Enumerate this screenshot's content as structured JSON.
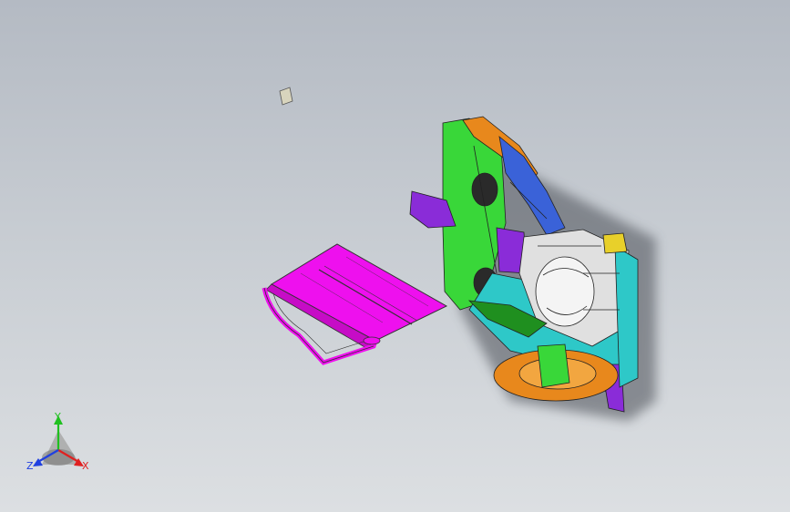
{
  "viewport": {
    "background_top": "#b4bac3",
    "background_bottom": "#dcdfe2"
  },
  "parts": {
    "small_square": {
      "color": "#d8d4bd"
    },
    "hood_panel": {
      "color": "#ee10ee"
    },
    "body_assembly": {
      "colors": [
        "#39d739",
        "#e8881c",
        "#8a2cd8",
        "#1aa6d8",
        "#2ec8c8",
        "#dcdcdc",
        "#e8d02a",
        "#3a62d8"
      ]
    }
  },
  "triad": {
    "x_label": "X",
    "y_label": "Y",
    "z_label": "Z",
    "x_color": "#e02020",
    "y_color": "#20c020",
    "z_color": "#2040e0"
  }
}
